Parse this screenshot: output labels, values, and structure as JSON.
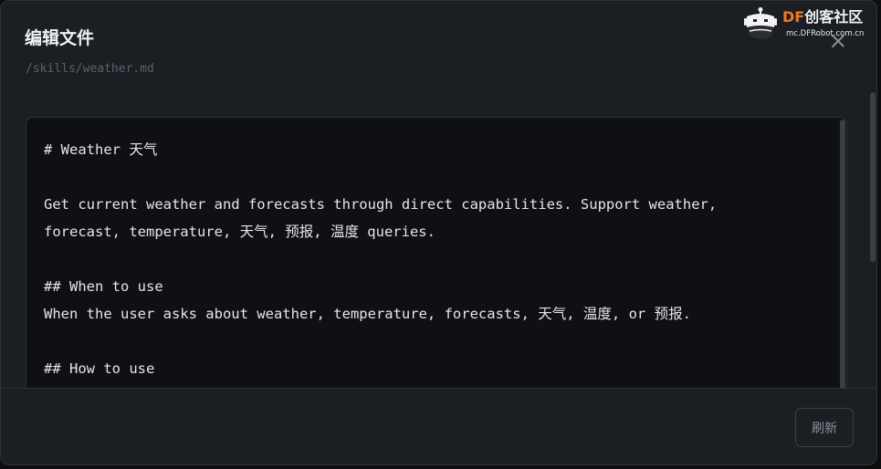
{
  "dialog": {
    "title": "编辑文件",
    "path": "/skills/weather.md",
    "close_icon": "close-icon"
  },
  "watermark": {
    "brand_prefix": "DF",
    "brand_suffix": "创客社区",
    "url": "mc.DFRobot.com.cn"
  },
  "editor": {
    "lines": [
      "# Weather 天气",
      "",
      "Get current weather and forecasts through direct capabilities. Support weather,",
      "forecast, temperature, 天气, 预报, 温度 queries.",
      "",
      "## When to use",
      "When the user asks about weather, temperature, forecasts, 天气, 温度, or 预报.",
      "",
      "## How to use",
      ""
    ]
  },
  "footer": {
    "refresh_label": "刷新"
  },
  "colors": {
    "dialog_bg": "#1b1e23",
    "editor_bg": "#0f1013",
    "text": "#e4e6ea",
    "muted": "#5b6068",
    "brand_orange": "#f07a1a"
  }
}
